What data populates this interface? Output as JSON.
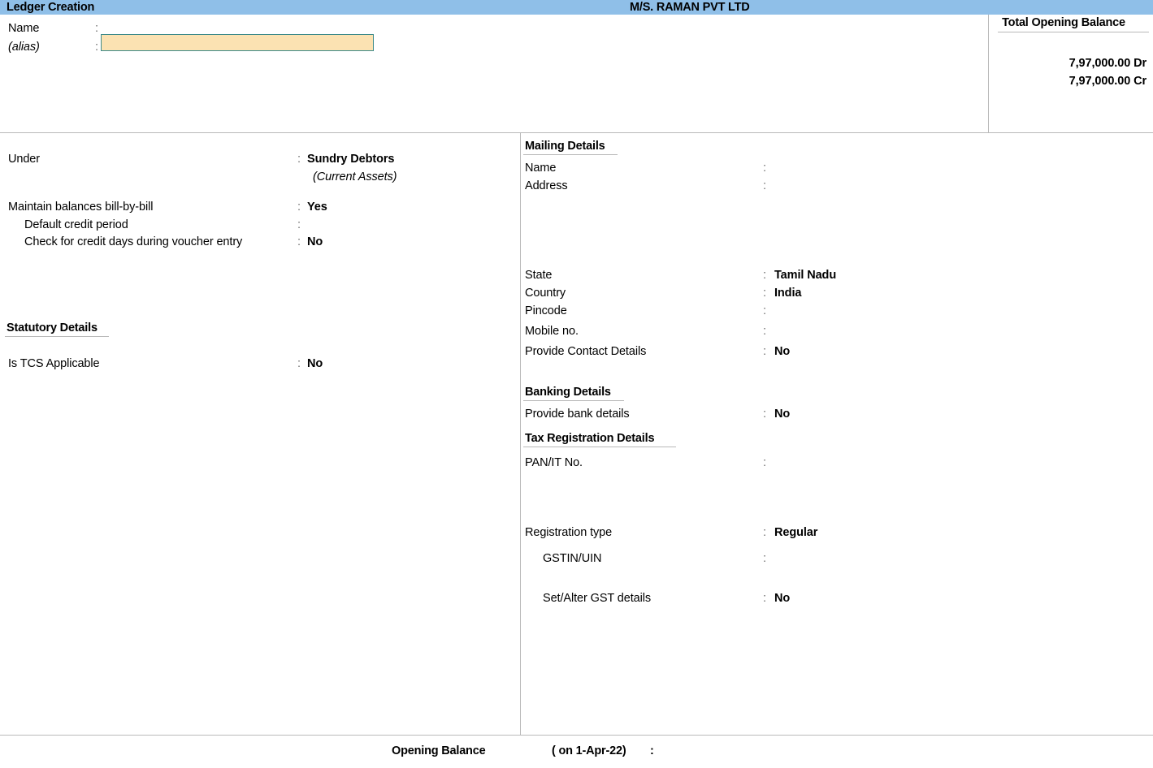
{
  "titlebar": {
    "screen_title": "Ledger Creation",
    "company_name": "M/S. RAMAN PVT LTD"
  },
  "name_panel": {
    "name_label": "Name",
    "name_value": "",
    "name_placeholder": "",
    "alias_label": "(alias)",
    "alias_value": "",
    "colon": ":"
  },
  "total_opening_balance": {
    "title": "Total Opening Balance",
    "debit": "7,97,000.00 Dr",
    "credit": "7,97,000.00 Cr"
  },
  "left_panel": {
    "under_label": "Under",
    "under_value": "Sundry Debtors",
    "under_group": "(Current Assets)",
    "bill_by_bill_label": "Maintain balances bill-by-bill",
    "bill_by_bill_value": "Yes",
    "credit_period_label": "Default credit period",
    "credit_period_value": "",
    "check_credit_days_label": "Check for credit days during voucher entry",
    "check_credit_days_value": "No",
    "statutory_heading": "Statutory Details",
    "tcs_label": "Is TCS Applicable",
    "tcs_value": "No",
    "colon": ":"
  },
  "right_panel": {
    "mailing_heading": "Mailing Details",
    "mailing_name_label": "Name",
    "mailing_name_value": "",
    "address_label": "Address",
    "address_value": "",
    "state_label": "State",
    "state_value": "Tamil Nadu",
    "country_label": "Country",
    "country_value": "India",
    "pincode_label": "Pincode",
    "pincode_value": "",
    "mobile_label": "Mobile no.",
    "mobile_value": "",
    "contact_details_label": "Provide Contact Details",
    "contact_details_value": "No",
    "banking_heading": "Banking Details",
    "bank_details_label": "Provide bank details",
    "bank_details_value": "No",
    "tax_heading": "Tax Registration Details",
    "pan_label": "PAN/IT No.",
    "pan_value": "",
    "registration_type_label": "Registration type",
    "registration_type_value": "Regular",
    "gstin_label": "GSTIN/UIN",
    "gstin_value": "",
    "set_alter_gst_label": "Set/Alter GST details",
    "set_alter_gst_value": "No",
    "colon": ":"
  },
  "footer": {
    "opening_balance_label": "Opening Balance",
    "as_on_label": "( on 1-Apr-22)",
    "colon": ":",
    "opening_balance_value": ""
  },
  "colors": {
    "titlebar_blue": "#8fbfe8",
    "input_fill": "#fbe2b2",
    "input_border": "#3c8a8a",
    "rule_gray": "#b9b9b9"
  }
}
